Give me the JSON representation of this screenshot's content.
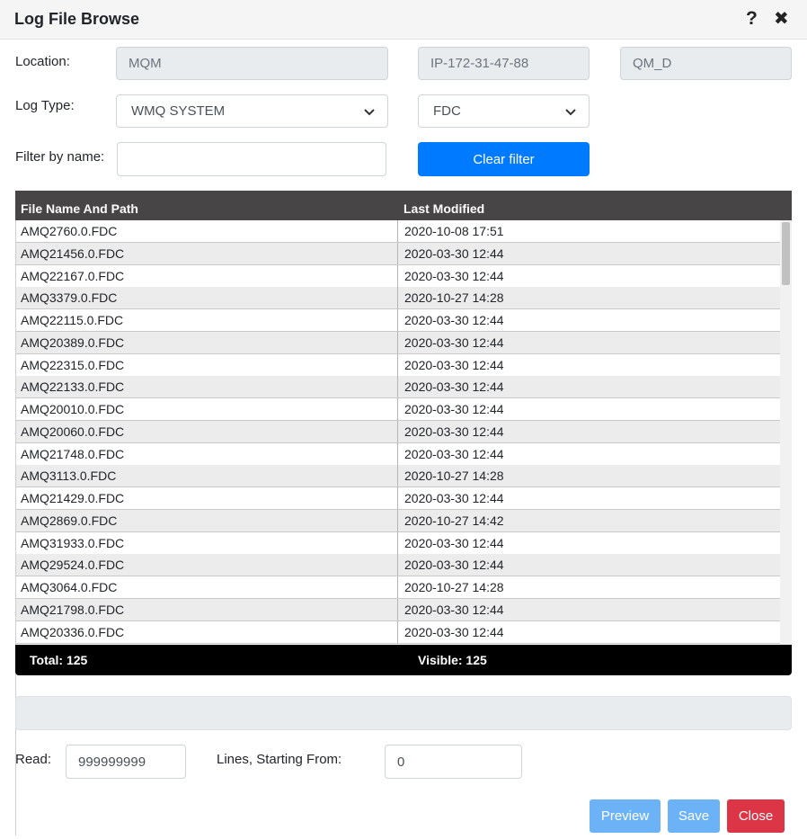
{
  "dialog": {
    "title": "Log File Browse",
    "help_icon": "?",
    "close_icon": "✖"
  },
  "form": {
    "location_label": "Location:",
    "location_value": "MQM",
    "host_value": "IP-172-31-47-88",
    "qmgr_value": "QM_D",
    "logtype_label": "Log Type:",
    "logtype_selected": "WMQ SYSTEM",
    "filetype_selected": "FDC",
    "filter_label": "Filter by name:",
    "filter_value": "",
    "clear_filter_label": "Clear filter"
  },
  "table": {
    "columns": [
      "File Name And Path",
      "Last Modified"
    ],
    "rows": [
      [
        "AMQ2760.0.FDC",
        "2020-10-08 17:51"
      ],
      [
        "AMQ21456.0.FDC",
        "2020-03-30 12:44"
      ],
      [
        "AMQ22167.0.FDC",
        "2020-03-30 12:44"
      ],
      [
        "AMQ3379.0.FDC",
        "2020-10-27 14:28"
      ],
      [
        "AMQ22115.0.FDC",
        "2020-03-30 12:44"
      ],
      [
        "AMQ20389.0.FDC",
        "2020-03-30 12:44"
      ],
      [
        "AMQ22315.0.FDC",
        "2020-03-30 12:44"
      ],
      [
        "AMQ22133.0.FDC",
        "2020-03-30 12:44"
      ],
      [
        "AMQ20010.0.FDC",
        "2020-03-30 12:44"
      ],
      [
        "AMQ20060.0.FDC",
        "2020-03-30 12:44"
      ],
      [
        "AMQ21748.0.FDC",
        "2020-03-30 12:44"
      ],
      [
        "AMQ3113.0.FDC",
        "2020-10-27 14:28"
      ],
      [
        "AMQ21429.0.FDC",
        "2020-03-30 12:44"
      ],
      [
        "AMQ2869.0.FDC",
        "2020-10-27 14:42"
      ],
      [
        "AMQ31933.0.FDC",
        "2020-03-30 12:44"
      ],
      [
        "AMQ29524.0.FDC",
        "2020-03-30 12:44"
      ],
      [
        "AMQ3064.0.FDC",
        "2020-10-27 14:28"
      ],
      [
        "AMQ21798.0.FDC",
        "2020-03-30 12:44"
      ],
      [
        "AMQ20336.0.FDC",
        "2020-03-30 12:44"
      ]
    ],
    "total_label": "Total: 125",
    "visible_label": "Visible: 125"
  },
  "read": {
    "read_label": "Read:",
    "read_value": "999999999",
    "lines_label": "Lines, Starting From:",
    "start_value": "0"
  },
  "buttons": {
    "preview": "Preview",
    "save": "Save",
    "close": "Close"
  },
  "colors": {
    "primary": "#007bff",
    "primary_light": "#6cb2f6",
    "danger": "#dc3545",
    "table_header": "#474545",
    "table_footer": "#000000"
  }
}
